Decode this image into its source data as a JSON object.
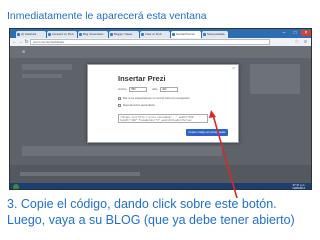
{
  "top_caption": "Inmediatamente le aparecerá esta ventana",
  "browser": {
    "tabs": [
      {
        "label": "(1) Facebook"
      },
      {
        "label": "Compartir en Prezi"
      },
      {
        "label": "Blog Universitario"
      },
      {
        "label": "Blogger: Clases"
      },
      {
        "label": "Crear un Prezi"
      },
      {
        "label": "Insertar Prezi en"
      },
      {
        "label": "Nueva pestaña"
      }
    ],
    "url": "prezi.com/embed/share"
  },
  "modal": {
    "title": "Insertar Prezi",
    "width_label": "Ancho",
    "width_value": "550",
    "height_label": "Alto",
    "height_value": "400",
    "option_1": "Dar a los espectadores el control sobre la navegación",
    "option_2": "Reproducción automática",
    "embed_code": "<iframe src=\"http://prezi.com/embed/...\" width=\"550\" height=\"400\" frameBorder=\"0\" webkitAllowFullScreen mozAllowFullscreen allowfullscreen></iframe>",
    "copy_button": "Copiar código al portapapeles"
  },
  "taskbar": {
    "time": "07:37 p.m.",
    "date": "11/05/2014"
  },
  "bottom_caption_line1": "3. Copie el código, dando click sobre este botón.",
  "bottom_caption_line2": "Luego, vaya a su BLOG (que ya debe tener abierto)"
}
